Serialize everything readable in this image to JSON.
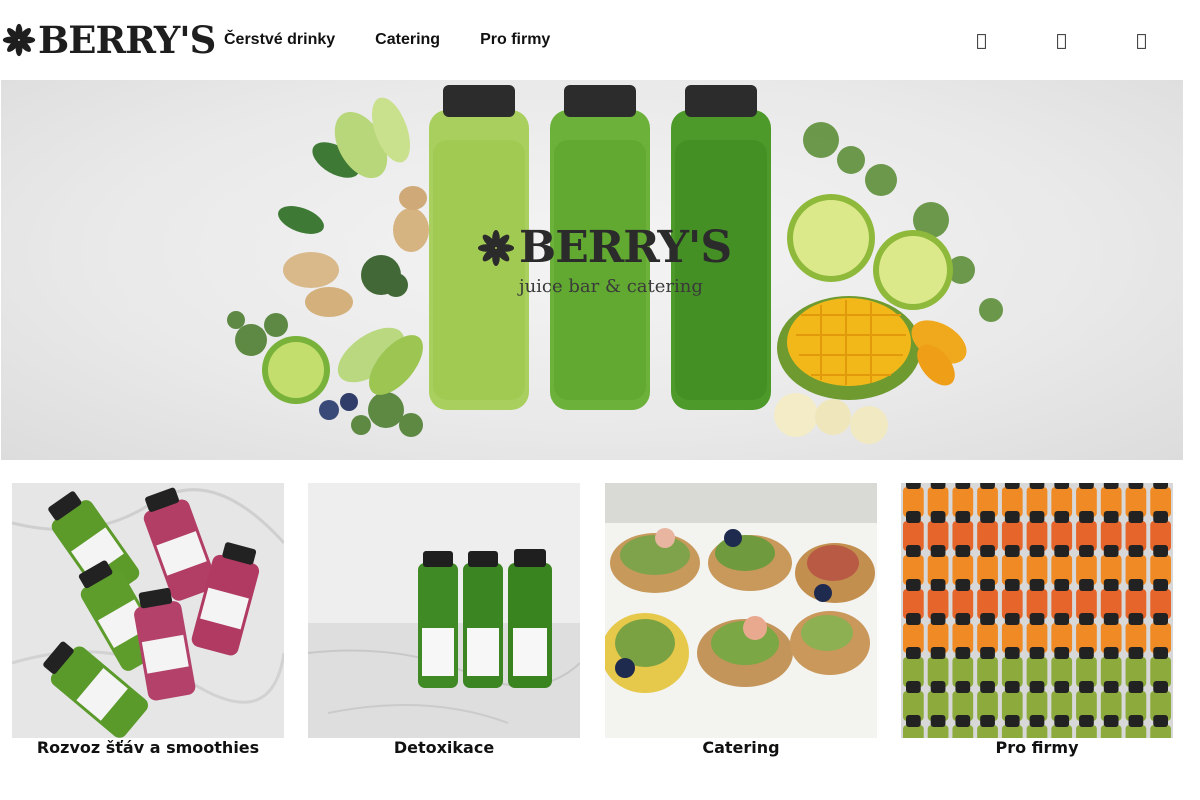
{
  "brand": {
    "logo_text": "BERRY'S",
    "hero_title": "BERRY'S",
    "hero_subtitle": "juice bar & catering"
  },
  "nav": {
    "items": [
      {
        "label": "Čerstvé drinky"
      },
      {
        "label": "Catering"
      },
      {
        "label": "Pro firmy"
      }
    ]
  },
  "header_icons": [
    "user-icon",
    "search-icon",
    "cart-icon"
  ],
  "cards": [
    {
      "caption": "Rozvoz šťáv a smoothies"
    },
    {
      "caption": "Detoxikace"
    },
    {
      "caption": "Catering"
    },
    {
      "caption": "Pro firmy"
    }
  ],
  "colors": {
    "text": "#111111",
    "logo": "#1e1e1e",
    "hero_background": "#ececec",
    "juice_green": "#6cab32",
    "juice_pink": "#b43b62",
    "juice_orange": "#e8692a"
  }
}
